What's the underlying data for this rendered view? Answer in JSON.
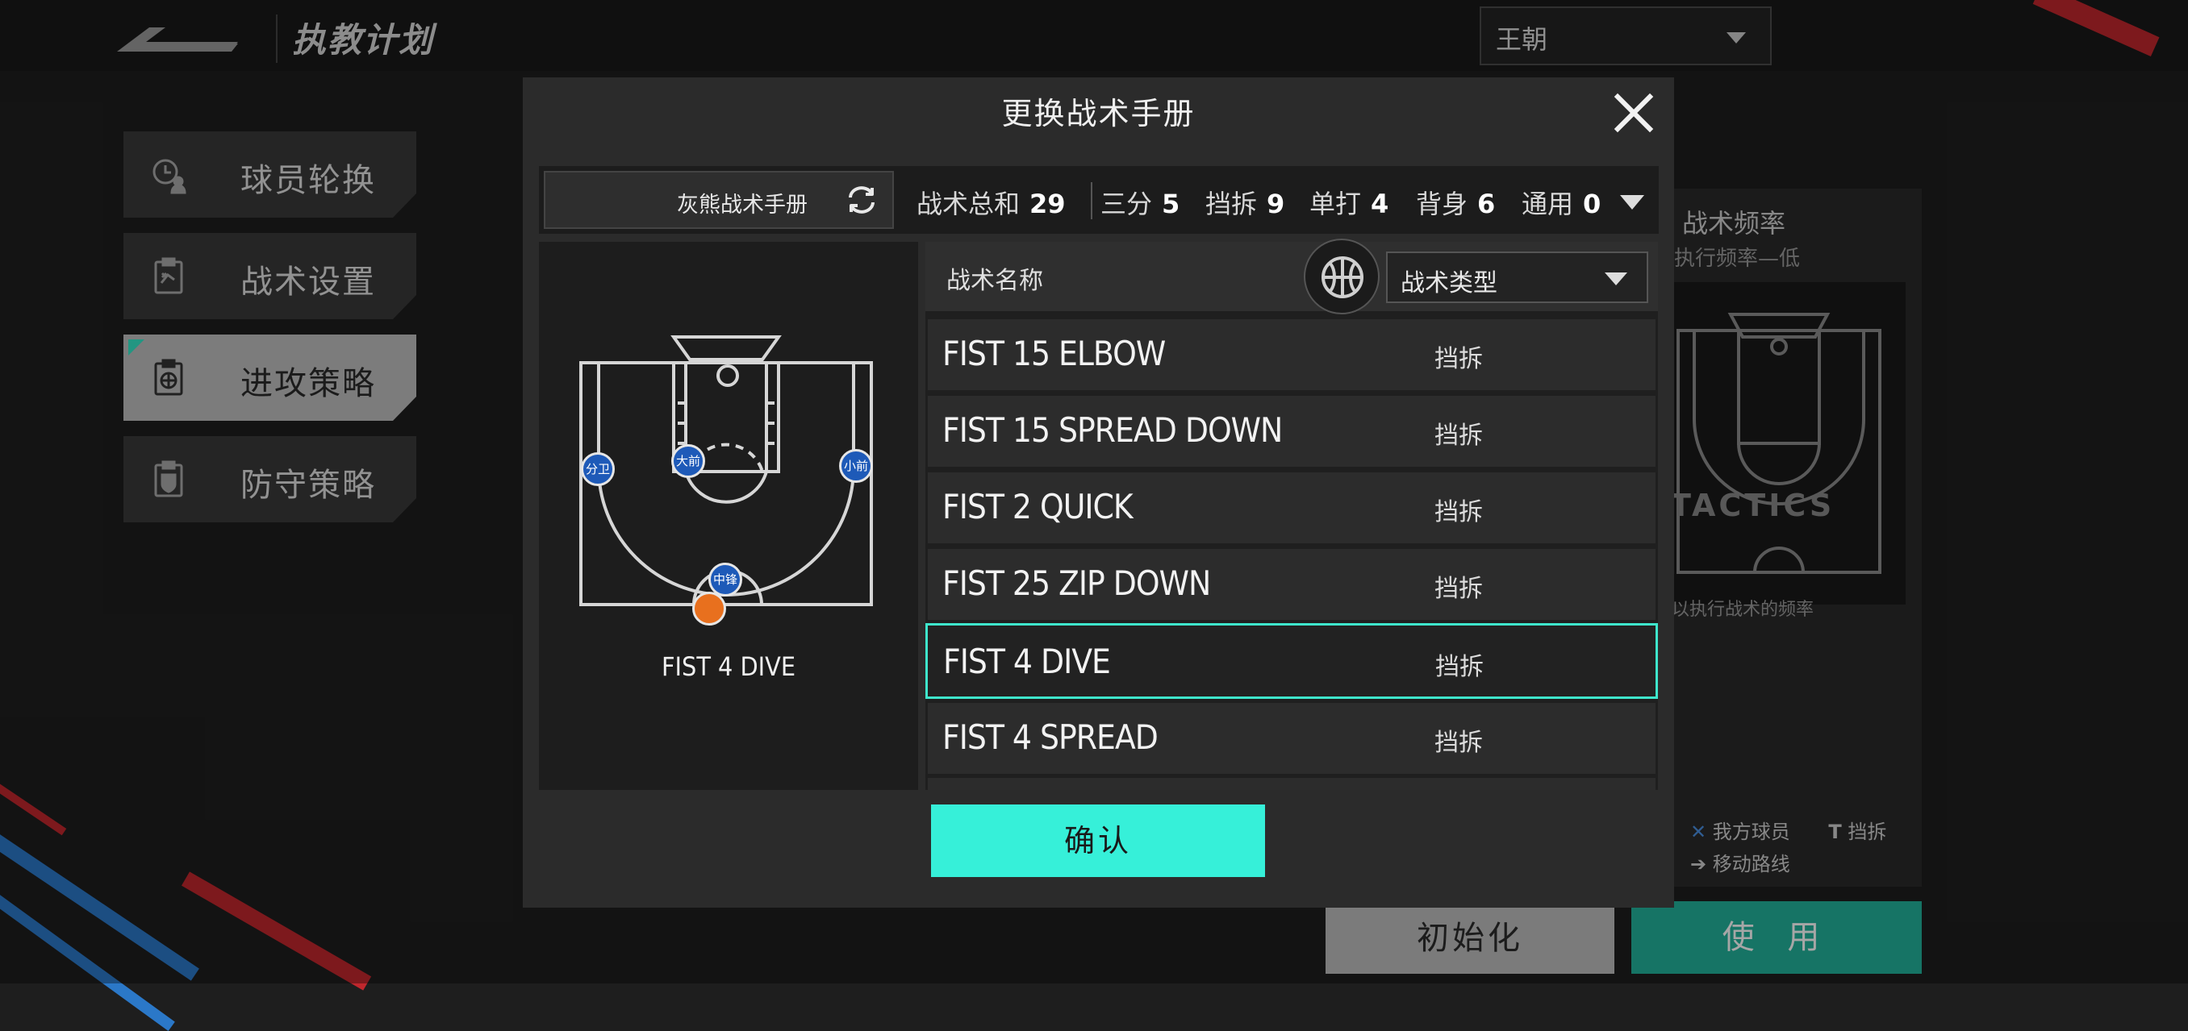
{
  "header": {
    "title": "执教计划",
    "team_select": "王朝"
  },
  "sidebar": {
    "items": [
      {
        "label": "球员轮换",
        "icon": "clock-user-icon",
        "active": false
      },
      {
        "label": "战术设置",
        "icon": "clipboard-play-icon",
        "active": false
      },
      {
        "label": "进攻策略",
        "icon": "clipboard-ball-icon",
        "active": true
      },
      {
        "label": "防守策略",
        "icon": "clipboard-shield-icon",
        "active": false
      }
    ]
  },
  "background_panel": {
    "title": "战术频率",
    "subtitle": "执行频率—低",
    "watermark": "TACTICS",
    "description": "以执行战术的频率",
    "legend_my_player": "我方球员",
    "legend_screen": "挡拆",
    "legend_move_route": "移动路线",
    "init_button": "初始化",
    "use_button": "使 用"
  },
  "modal": {
    "title": "更换战术手册",
    "manual_name": "灰熊战术手册",
    "stats": {
      "total_label": "战术总和",
      "total": "29",
      "three_label": "三分",
      "three": "5",
      "screen_label": "挡拆",
      "screen": "9",
      "iso_label": "单打",
      "iso": "4",
      "post_label": "背身",
      "post": "6",
      "general_label": "通用",
      "general": "0"
    },
    "list_header": {
      "name": "战术名称",
      "type_select": "战术类型"
    },
    "tactics": [
      {
        "name": "FIST 15 ELBOW",
        "type": "挡拆",
        "selected": false
      },
      {
        "name": "FIST 15 SPREAD DOWN",
        "type": "挡拆",
        "selected": false
      },
      {
        "name": "FIST 2 QUICK",
        "type": "挡拆",
        "selected": false
      },
      {
        "name": "FIST 25 ZIP DOWN",
        "type": "挡拆",
        "selected": false
      },
      {
        "name": "FIST 4 DIVE",
        "type": "挡拆",
        "selected": true
      },
      {
        "name": "FIST 4 SPREAD",
        "type": "挡拆",
        "selected": false
      }
    ],
    "preview": {
      "play_name": "FIST 4 DIVE",
      "players": {
        "sg": "分卫",
        "pf": "大前",
        "sf": "小前",
        "c": "中锋"
      }
    },
    "confirm_button": "确认"
  },
  "colors": {
    "accent": "#36f0d9",
    "use_button": "#22b39b",
    "selected_border": "#3ee6cc",
    "player_marker": "#1e5ab8",
    "ball_marker": "#e8701e"
  }
}
